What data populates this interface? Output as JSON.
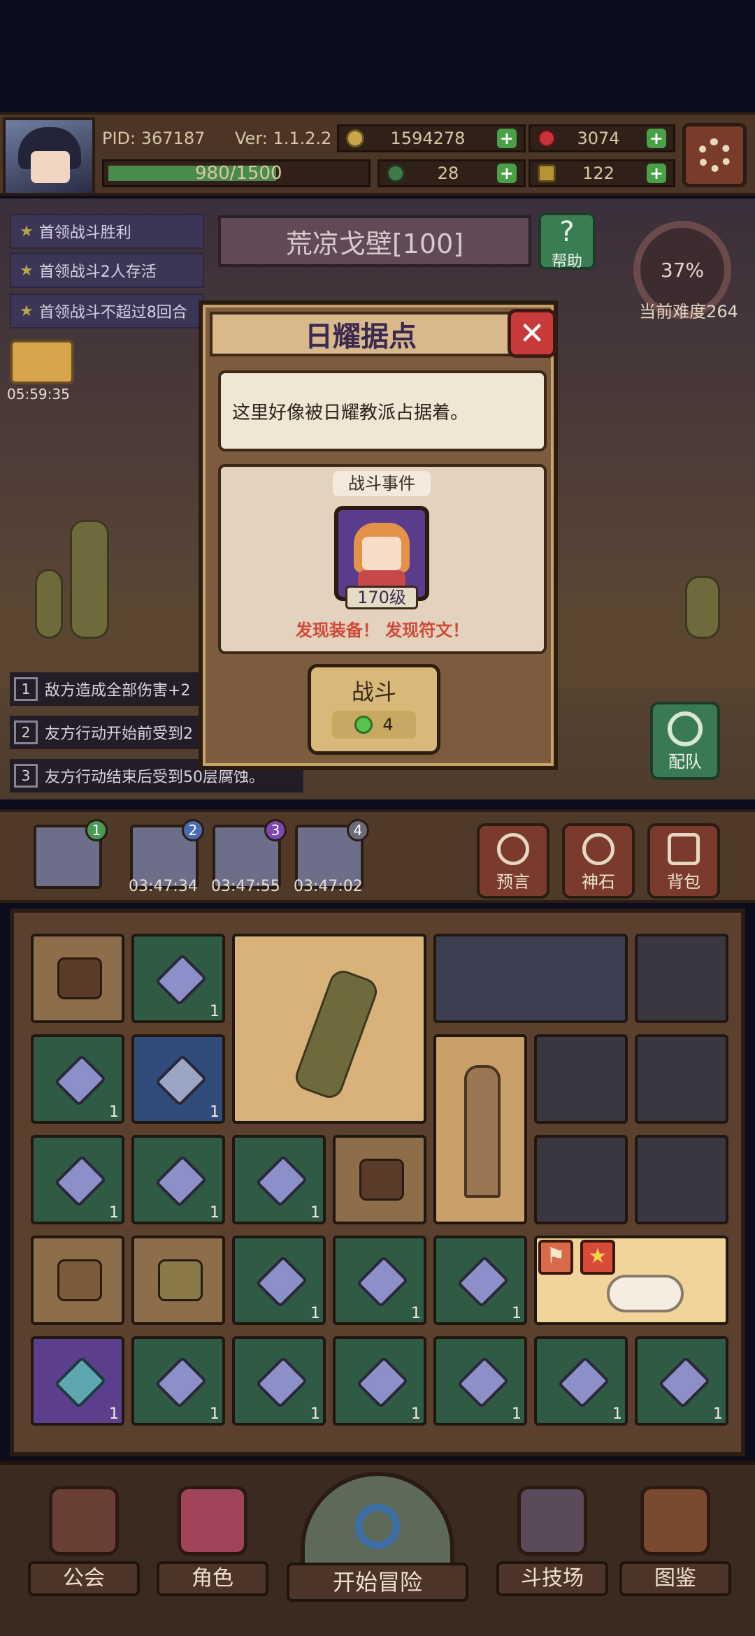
{
  "header": {
    "pid": "PID: 367187",
    "version": "Ver: 1.1.2.2",
    "gold": "1594278",
    "ruby": "3074",
    "hp": "980/1500",
    "clover": "28",
    "key": "122",
    "hp_fraction": 0.653
  },
  "quests": [
    "首领战斗胜利",
    "首领战斗2人存活",
    "首领战斗不超过8回合"
  ],
  "stage": {
    "name": "荒凉戈壁[100]",
    "help_label": "帮助",
    "progress": "37%",
    "difficulty_label": "当前难度264",
    "gift_timer": "05:59:35"
  },
  "modifiers": [
    {
      "num": "1",
      "text": "敌方造成全部伤害+2"
    },
    {
      "num": "2",
      "text": "友方行动开始前受到2"
    },
    {
      "num": "3",
      "text": "友方行动结束后受到50层腐蚀。"
    }
  ],
  "team_label": "配队",
  "modal": {
    "title": "日耀据点",
    "description": "这里好像被日耀教派占据着。",
    "event_title": "战斗事件",
    "level": "170级",
    "reward_text": "发现装备！ 发现符文！",
    "fight_label": "战斗",
    "fight_cost": "4"
  },
  "expeditions": {
    "badges": [
      "1",
      "2",
      "3",
      "4"
    ],
    "timers": [
      "03:47:34",
      "03:47:55",
      "03:47:02"
    ],
    "buttons": [
      "预言",
      "神石",
      "背包"
    ]
  },
  "inventory": {
    "qty": "1"
  },
  "bottom_nav": [
    "公会",
    "角色",
    "开始冒险",
    "斗技场",
    "图鉴"
  ],
  "colors": {
    "accent_red": "#cf4a3a",
    "title_purple": "#3a2a4f",
    "green_gem": "#58c24a"
  }
}
